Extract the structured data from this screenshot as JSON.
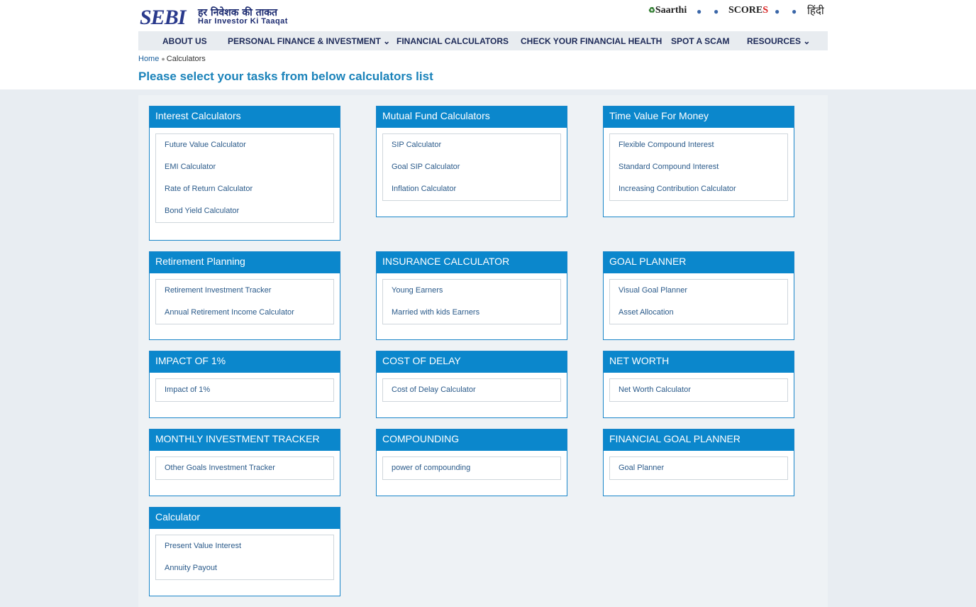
{
  "header": {
    "logo_mark": "SEBI",
    "logo_hindi": "हर निवेशक की ताकत",
    "logo_english": "Har Investor Ki Taaqat",
    "saarthi": "Saarthi",
    "scores_main": "SCORE",
    "scores_s": "S",
    "hindi": "हिंदी"
  },
  "nav": [
    {
      "label": "ABOUT US"
    },
    {
      "label": "PERSONAL FINANCE & INVESTMENT ⌄"
    },
    {
      "label": "FINANCIAL CALCULATORS"
    },
    {
      "label": "CHECK YOUR FINANCIAL HEALTH"
    },
    {
      "label": "SPOT A SCAM"
    },
    {
      "label": "RESOURCES ⌄"
    }
  ],
  "breadcrumb": {
    "home": "Home",
    "current": "Calculators"
  },
  "page_title": "Please select your tasks from below calculators list",
  "cards": [
    {
      "title": "Interest Calculators",
      "links": [
        "Future Value Calculator",
        "EMI Calculator",
        "Rate of Return Calculator",
        "Bond Yield Calculator"
      ]
    },
    {
      "title": "Mutual Fund Calculators",
      "links": [
        "SIP Calculator",
        "Goal SIP Calculator",
        "Inflation Calculator"
      ]
    },
    {
      "title": "Time Value For Money",
      "links": [
        "Flexible Compound Interest",
        "Standard Compound Interest",
        "Increasing Contribution Calculator"
      ]
    },
    {
      "title": "Retirement Planning",
      "links": [
        "Retirement Investment Tracker",
        "Annual Retirement Income Calculator"
      ]
    },
    {
      "title": "INSURANCE CALCULATOR",
      "links": [
        "Young Earners",
        "Married with kids Earners"
      ]
    },
    {
      "title": "GOAL PLANNER",
      "links": [
        "Visual Goal Planner",
        "Asset Allocation"
      ]
    },
    {
      "title": "IMPACT OF 1%",
      "links": [
        "Impact of 1%"
      ]
    },
    {
      "title": "COST OF DELAY",
      "links": [
        "Cost of Delay Calculator"
      ]
    },
    {
      "title": "NET WORTH",
      "links": [
        "Net Worth Calculator"
      ]
    },
    {
      "title": "MONTHLY INVESTMENT TRACKER",
      "links": [
        "Other Goals Investment Tracker"
      ]
    },
    {
      "title": "COMPOUNDING",
      "links": [
        "power of compounding"
      ]
    },
    {
      "title": "FINANCIAL GOAL PLANNER",
      "links": [
        "Goal Planner"
      ]
    },
    {
      "title": "Calculator",
      "links": [
        "Present Value Interest",
        "Annuity Payout"
      ]
    }
  ]
}
